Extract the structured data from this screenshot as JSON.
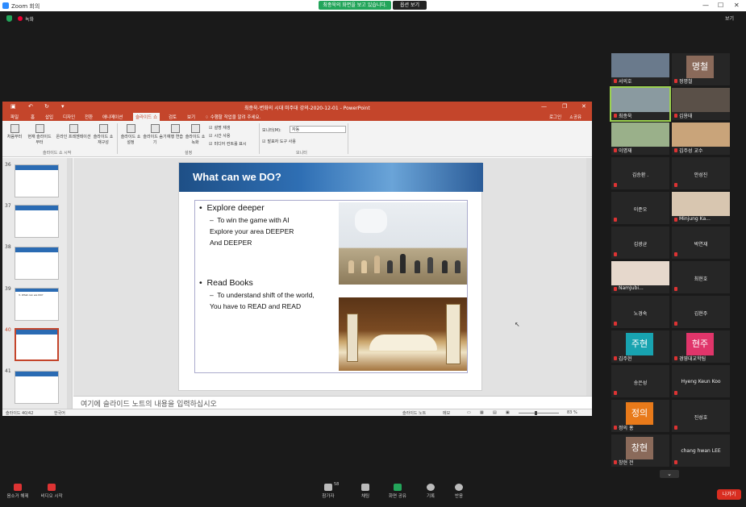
{
  "zoom": {
    "window_title": "Zoom 회의",
    "share_banner": "최종욱의 화면을 보고 있습니다.",
    "view_options": "옵션 보기",
    "recording": "녹화",
    "view_button": "보기",
    "controls": [
      "—",
      "☐",
      "✕"
    ]
  },
  "ppt": {
    "title": "최종욱-변화의 시대 미주대 강의-2020-12-01 - PowerPoint",
    "tabs": [
      "파일",
      "홈",
      "삽입",
      "디자인",
      "전환",
      "애니메이션",
      "슬라이드 쇼",
      "검토",
      "보기"
    ],
    "active_tab": "슬라이드 쇼",
    "tell_me": "수행할 작업을 알려 주세요.",
    "login": "로그인",
    "share": "공유",
    "ribbon": {
      "buttons": [
        "처음부터",
        "현재 슬라이드부터",
        "온라인 프레젠테이션",
        "슬라이드 쇼 재구성",
        "슬라이드 쇼 설정",
        "슬라이드 숨기기",
        "예행 연습",
        "슬라이드 쇼 녹화"
      ],
      "checks": [
        "설명 재생",
        "시간 사용",
        "미디어 컨트롤 표시"
      ],
      "monitor_label": "모니터(M):",
      "monitor_value": "자동",
      "presenter_view": "발표자 도구 사용",
      "groups": [
        "슬라이드 쇼 시작",
        "설정",
        "모니터"
      ]
    },
    "thumbnails": [
      {
        "num": "36",
        "title": ""
      },
      {
        "num": "37",
        "title": ""
      },
      {
        "num": "38",
        "title": ""
      },
      {
        "num": "39",
        "title": "3. What can we DO?"
      },
      {
        "num": "40",
        "title": ""
      },
      {
        "num": "41",
        "title": ""
      }
    ],
    "selected_slide": "40",
    "slide": {
      "title": "What can we DO?",
      "bullet1": "Explore deeper",
      "sub1_line1": "To win the game  with AI",
      "sub1_line2": "Explore your area DEEPER",
      "sub1_line3": "And DEEPER",
      "bullet2": "Read Books",
      "sub2_line1": "To understand shift of the world,",
      "sub2_line2": "You have to READ and READ"
    },
    "notes_placeholder": "여기에 슬라이드 노트의 내용을 입력하십시오",
    "status": {
      "slide_count": "슬라이드 40/42",
      "language": "한국어",
      "notes_btn": "슬라이드 노트",
      "comments_btn": "메모",
      "zoom": "83 %"
    }
  },
  "participants": [
    {
      "name": "서의호",
      "type": "photo",
      "color": "#6a7a8c"
    },
    {
      "name": "정명철",
      "type": "avatar",
      "avatar": "명철",
      "color": "#8a6a5a"
    },
    {
      "name": "최종욱",
      "type": "photo",
      "color": "#8a9aa0",
      "highlight": true
    },
    {
      "name": "김용태",
      "type": "photo",
      "color": "#5a5048"
    },
    {
      "name": "이명재",
      "type": "photo",
      "color": "#9ab08a"
    },
    {
      "name": "김주성 교수",
      "type": "photo",
      "color": "#c9a47a"
    },
    {
      "name": "김승환 .",
      "type": "name"
    },
    {
      "name": "안성진",
      "type": "name"
    },
    {
      "name": "이준오",
      "type": "name"
    },
    {
      "name": "Minjung Ka...",
      "type": "photo",
      "color": "#d8c6b0"
    },
    {
      "name": "김광균",
      "type": "name"
    },
    {
      "name": "박연재",
      "type": "name"
    },
    {
      "name": "NamJubi...",
      "type": "photo",
      "color": "#e6d8cc"
    },
    {
      "name": "최현호",
      "type": "name"
    },
    {
      "name": "노경숙",
      "type": "name"
    },
    {
      "name": "김현주",
      "type": "name"
    },
    {
      "name": "김주현",
      "type": "avatar",
      "avatar": "주현",
      "color": "#18a3b0"
    },
    {
      "name": "경영대교학팀",
      "type": "avatar",
      "avatar": "현주",
      "color": "#e0356a"
    },
    {
      "name": "송은성",
      "type": "name"
    },
    {
      "name": "Hyeng Keun Koo",
      "type": "name"
    },
    {
      "name": "정의 홍",
      "type": "avatar",
      "avatar": "정의",
      "color": "#e87a1a"
    },
    {
      "name": "진성호",
      "type": "name"
    },
    {
      "name": "창현 전",
      "type": "avatar",
      "avatar": "창현",
      "color": "#8a6a5a"
    },
    {
      "name": "chang hwan LEE",
      "type": "name"
    }
  ],
  "toolbar": {
    "mute": "음소거 해제",
    "video": "비디오 시작",
    "participants": "참가자",
    "participants_count": "58",
    "chat": "채팅",
    "share": "화면 공유",
    "record": "기록",
    "reactions": "반응",
    "leave": "나가기"
  },
  "colors": {
    "ppt_accent": "#c4452b",
    "zoom_green": "#23a55a",
    "leave_red": "#d92d20"
  }
}
